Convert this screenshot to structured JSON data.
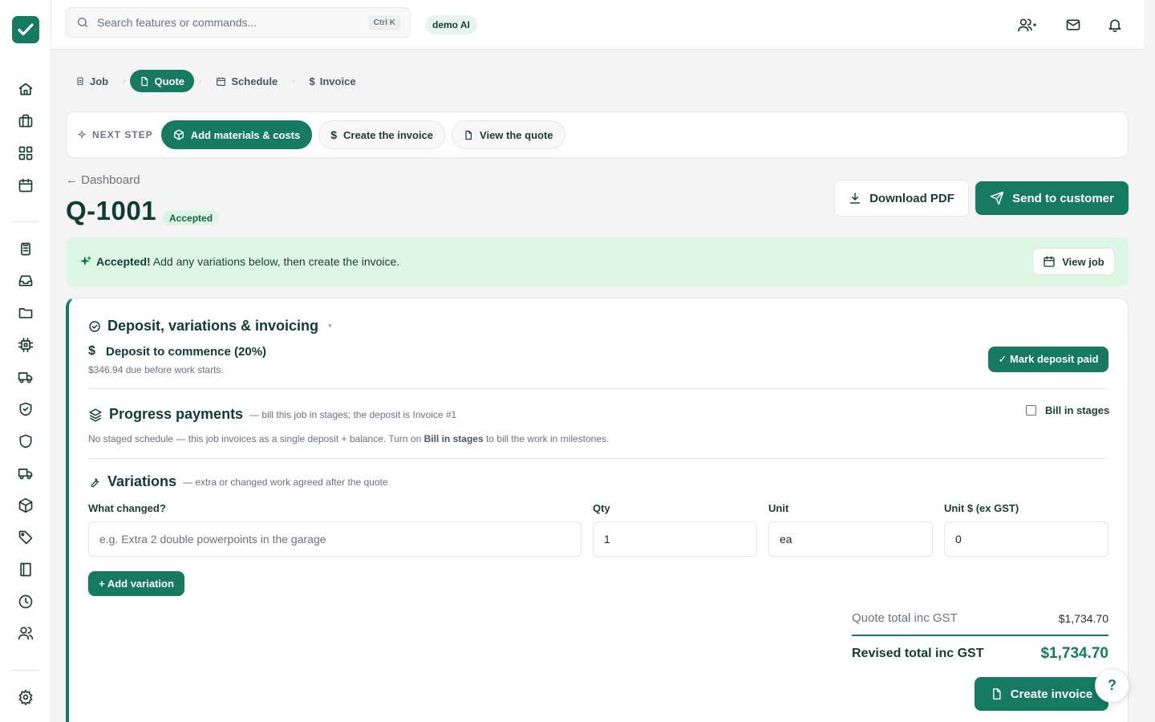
{
  "app": {
    "name": "Trade job manager",
    "brand_color": "#167a63"
  },
  "sidebar": {
    "items": [
      {
        "icon": "home-icon"
      },
      {
        "icon": "briefcase-icon"
      },
      {
        "icon": "grid-icon"
      },
      {
        "icon": "calendar-icon"
      },
      {
        "icon": "clipboard-icon"
      },
      {
        "icon": "inbox-icon"
      },
      {
        "icon": "folder-icon"
      },
      {
        "icon": "chip-icon"
      },
      {
        "icon": "truck-icon"
      },
      {
        "icon": "shield-check-icon"
      },
      {
        "icon": "shield-icon"
      },
      {
        "icon": "truck-icon"
      },
      {
        "icon": "box-icon"
      },
      {
        "icon": "tag-icon"
      },
      {
        "icon": "book-icon"
      },
      {
        "icon": "clock-icon"
      },
      {
        "icon": "users-icon"
      },
      {
        "icon": "settings-icon"
      }
    ]
  },
  "topbar": {
    "search_placeholder": "Search features or commands...",
    "shortcut": "Ctrl K",
    "org_badge": "demo AI",
    "icons": [
      "team-icon",
      "mail-icon",
      "bell-icon"
    ]
  },
  "stepper": {
    "steps": [
      {
        "label": "Job",
        "icon": "clipboard-icon",
        "active": false
      },
      {
        "label": "Quote",
        "icon": "file-icon",
        "active": true
      },
      {
        "label": "Schedule",
        "icon": "calendar-icon",
        "active": false
      },
      {
        "label": "Invoice",
        "icon": "dollar-icon",
        "active": false
      }
    ]
  },
  "next_step": {
    "label": "NEXT STEP",
    "actions": [
      {
        "label": "Add materials & costs",
        "icon": "box-icon",
        "primary": true
      },
      {
        "label": "Create the invoice",
        "icon": "dollar-icon",
        "primary": false
      },
      {
        "label": "View the quote",
        "icon": "file-icon",
        "primary": false
      }
    ]
  },
  "header": {
    "back_label": "← Dashboard",
    "quote_number": "Q-1001",
    "status": "Accepted",
    "download_label": "Download PDF",
    "send_label": "Send to customer"
  },
  "banner": {
    "strong": "Accepted!",
    "text": " Add any variations below, then create the invoice.",
    "view_job_label": "View job"
  },
  "invoicing": {
    "title": "Deposit, variations & invoicing",
    "deposit": {
      "title": "Deposit to commence (20%)",
      "subtitle": "$346.94 due before work starts.",
      "button": "✓ Mark deposit paid"
    },
    "progress": {
      "title": "Progress payments",
      "subtitle": "— bill this job in stages; the deposit is Invoice #1",
      "toggle_label": "Bill in stages",
      "toggle_checked": false,
      "note_before": "No staged schedule — this job invoices as a single deposit + balance. Turn on ",
      "note_strong": "Bill in stages",
      "note_after": " to bill the work in milestones."
    },
    "variations": {
      "title": "Variations",
      "subtitle": "— extra or changed work agreed after the quote",
      "columns": [
        "What changed?",
        "Qty",
        "Unit",
        "Unit $ (ex GST)"
      ],
      "row": {
        "description_placeholder": "e.g. Extra 2 double powerpoints in the garage",
        "qty": "1",
        "unit": "ea",
        "unit_price": "0"
      },
      "add_button": "+ Add variation"
    },
    "totals": {
      "quote_label": "Quote total inc GST",
      "quote_value": "$1,734.70",
      "revised_label": "Revised total inc GST",
      "revised_value": "$1,734.70"
    },
    "create_invoice_label": "Create invoice"
  },
  "help": {
    "label": "?"
  }
}
